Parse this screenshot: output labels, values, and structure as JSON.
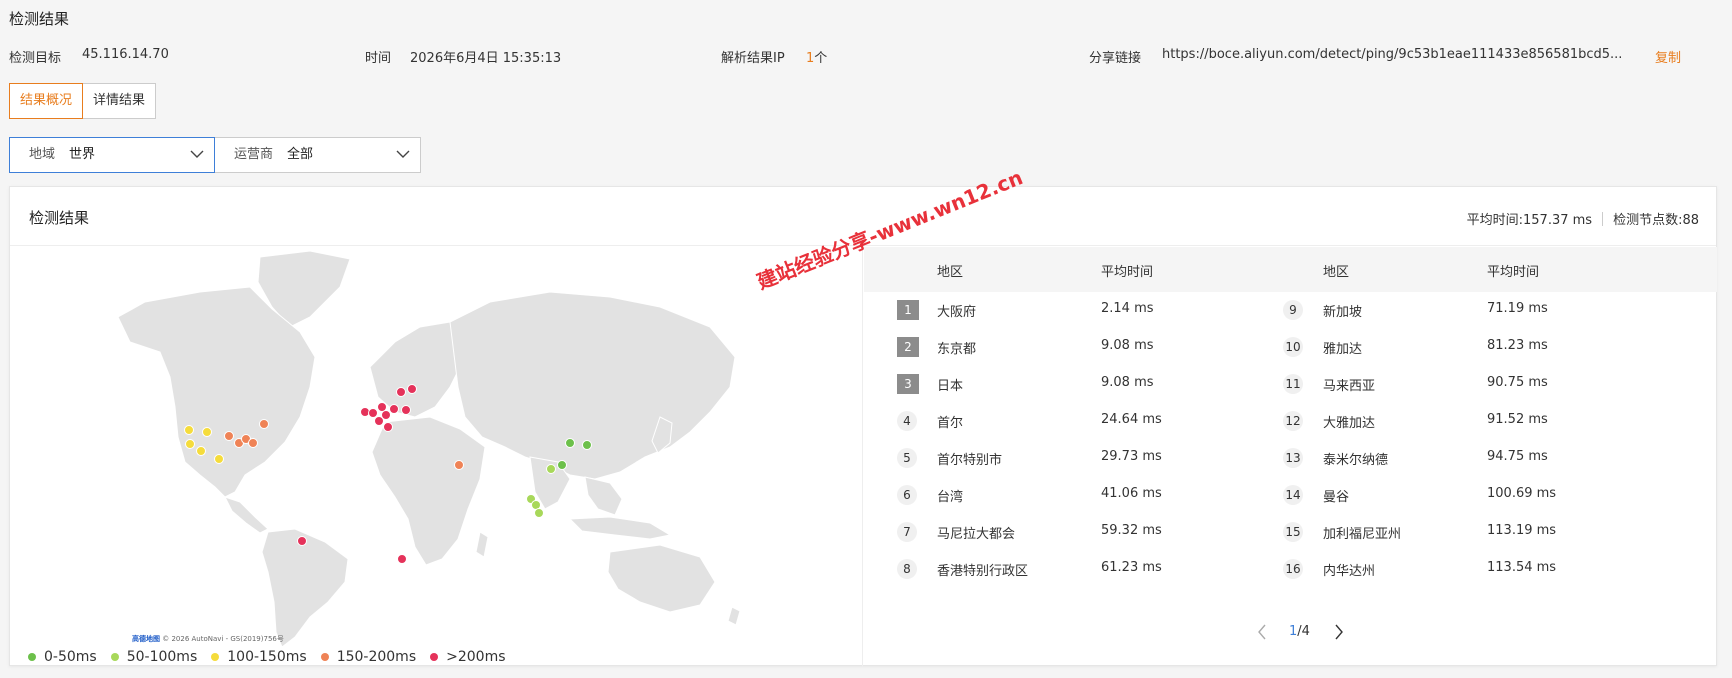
{
  "page_title": "检测结果",
  "info": {
    "target_label": "检测目标",
    "target_value": "45.116.14.70",
    "time_label": "时间",
    "time_value": "2026年6月4日 15:35:13",
    "ip_label": "解析结果IP",
    "ip_count": "1",
    "ip_unit": "个",
    "share_label": "分享链接",
    "share_url": "https://boce.aliyun.com/detect/ping/9c53b1eae111433e856581bcd5...",
    "copy_label": "复制"
  },
  "tabs": [
    {
      "label": "结果概况",
      "active": true
    },
    {
      "label": "详情结果",
      "active": false
    }
  ],
  "filters": {
    "region_label": "地域",
    "region_value": "世界",
    "isp_label": "运营商",
    "isp_value": "全部"
  },
  "card": {
    "title": "检测结果",
    "avg_time_text": "平均时间:157.37 ms",
    "node_count_text": "检测节点数:88"
  },
  "map": {
    "credit_logo": "高德地图",
    "credit_text": "© 2026 AutoNavi - GS(2019)756号",
    "legend": [
      {
        "label": "0-50ms",
        "color": "#6cc04a"
      },
      {
        "label": "50-100ms",
        "color": "#a8d85a"
      },
      {
        "label": "100-150ms",
        "color": "#f5dc3c"
      },
      {
        "label": "150-200ms",
        "color": "#ef8356"
      },
      {
        "label": ">200ms",
        "color": "#e5325a"
      }
    ]
  },
  "watermark": "建站经验分享-www.wn12.cn",
  "table": {
    "headers": {
      "region": "地区",
      "avg": "平均时间"
    },
    "rows": [
      {
        "rank": "1",
        "region": "大阪府",
        "avg": "2.14 ms"
      },
      {
        "rank": "2",
        "region": "东京都",
        "avg": "9.08 ms"
      },
      {
        "rank": "3",
        "region": "日本",
        "avg": "9.08 ms"
      },
      {
        "rank": "4",
        "region": "首尔",
        "avg": "24.64 ms"
      },
      {
        "rank": "5",
        "region": "首尔特别市",
        "avg": "29.73 ms"
      },
      {
        "rank": "6",
        "region": "台湾",
        "avg": "41.06 ms"
      },
      {
        "rank": "7",
        "region": "马尼拉大都会",
        "avg": "59.32 ms"
      },
      {
        "rank": "8",
        "region": "香港特别行政区",
        "avg": "61.23 ms"
      },
      {
        "rank": "9",
        "region": "新加坡",
        "avg": "71.19 ms"
      },
      {
        "rank": "10",
        "region": "雅加达",
        "avg": "81.23 ms"
      },
      {
        "rank": "11",
        "region": "马来西亚",
        "avg": "90.75 ms"
      },
      {
        "rank": "12",
        "region": "大雅加达",
        "avg": "91.52 ms"
      },
      {
        "rank": "13",
        "region": "泰米尔纳德",
        "avg": "94.75 ms"
      },
      {
        "rank": "14",
        "region": "曼谷",
        "avg": "100.69 ms"
      },
      {
        "rank": "15",
        "region": "加利福尼亚州",
        "avg": "113.19 ms"
      },
      {
        "rank": "16",
        "region": "内华达州",
        "avg": "113.54 ms"
      }
    ]
  },
  "pager": {
    "current": "1",
    "total": "/4"
  }
}
